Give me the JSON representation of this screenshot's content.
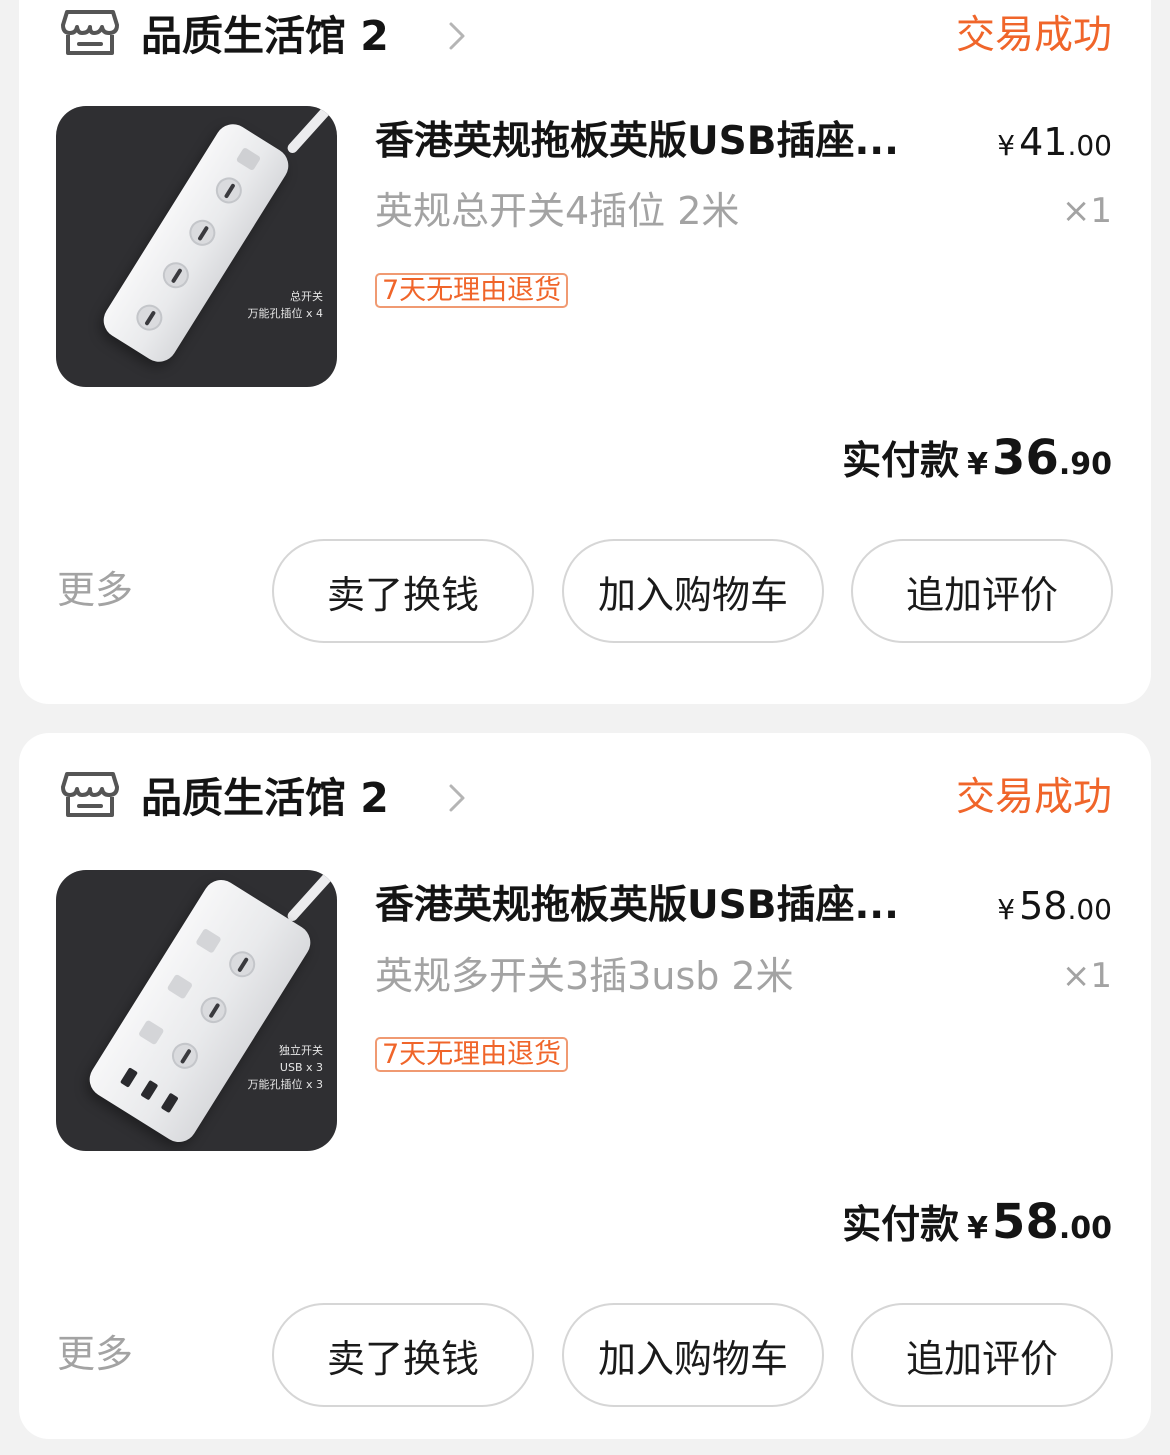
{
  "orders": [
    {
      "store_name": "品质生活馆 2",
      "status": "交易成功",
      "product": {
        "title": "香港英规拖板英版USB插座...",
        "price_yen": "¥",
        "price_int": "41",
        "price_dec": ".00",
        "spec": "英规总开关4插位 2米",
        "qty": "×1",
        "tag": "7天无理由退货",
        "image_caption": [
          "总开关",
          "万能孔插位 x 4"
        ]
      },
      "paid_label": "实付款",
      "paid_yen": "¥",
      "paid_int": "36",
      "paid_dec": ".90",
      "more_label": "更多",
      "actions": [
        "卖了换钱",
        "加入购物车",
        "追加评价"
      ]
    },
    {
      "store_name": "品质生活馆 2",
      "status": "交易成功",
      "product": {
        "title": "香港英规拖板英版USB插座...",
        "price_yen": "¥",
        "price_int": "58",
        "price_dec": ".00",
        "spec": "英规多开关3插3usb 2米",
        "qty": "×1",
        "tag": "7天无理由退货",
        "image_caption": [
          "独立开关",
          "USB x 3",
          "万能孔插位 x 3"
        ]
      },
      "paid_label": "实付款",
      "paid_yen": "¥",
      "paid_int": "58",
      "paid_dec": ".00",
      "more_label": "更多",
      "actions": [
        "卖了换钱",
        "加入购物车",
        "追加评价"
      ]
    }
  ],
  "icons": {
    "store": "store-icon",
    "chevron": "chevron-right-icon"
  },
  "colors": {
    "status": "#f0652a",
    "muted": "#a3a3a3",
    "background": "#f2f2f2",
    "image_bg": "#2f2f32"
  }
}
